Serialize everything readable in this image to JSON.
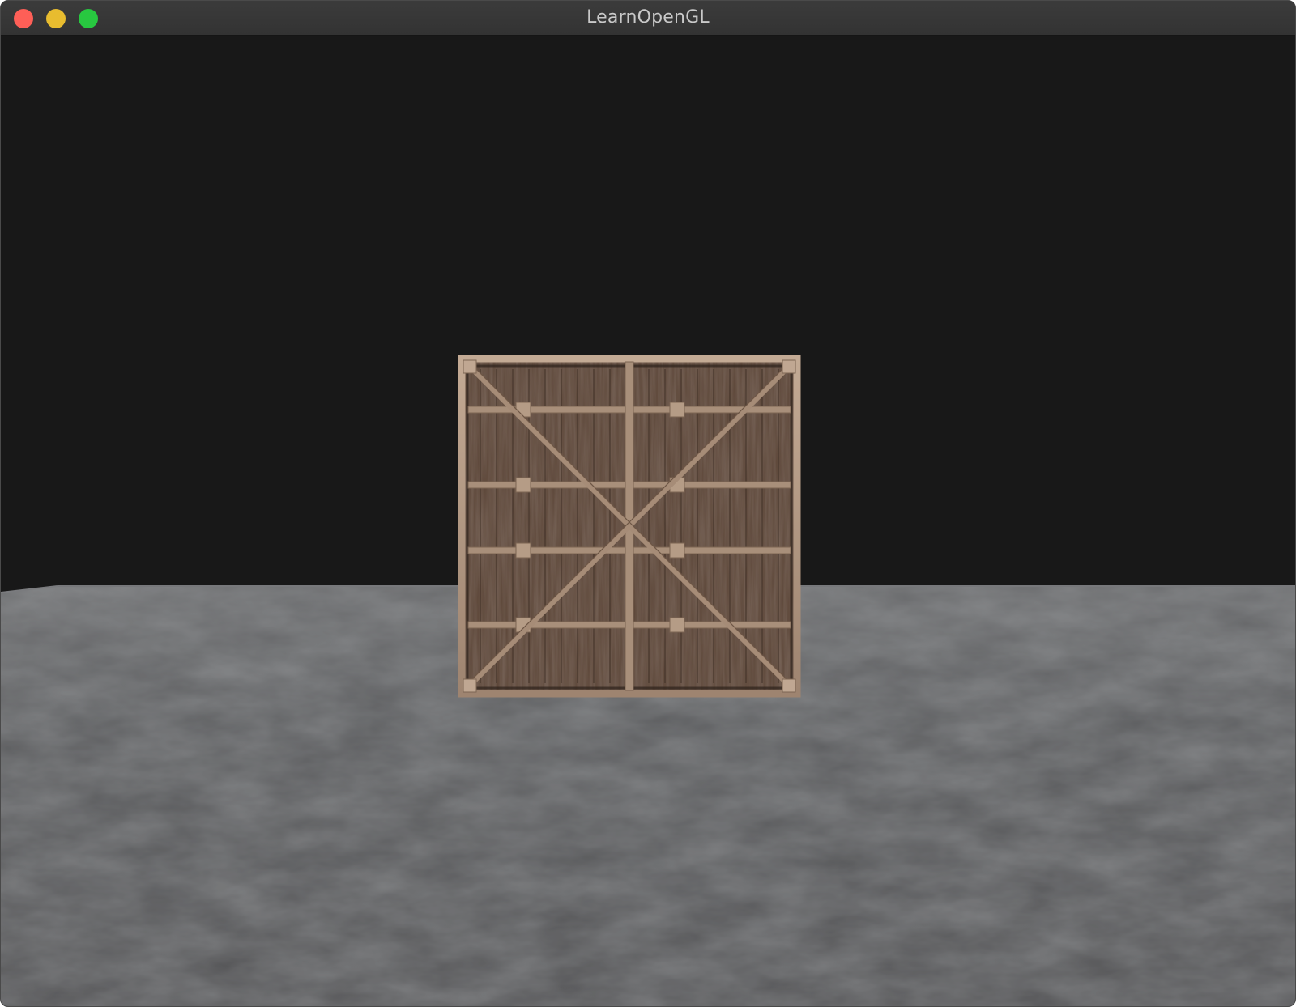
{
  "window": {
    "title": "LearnOpenGL",
    "buttons": [
      {
        "name": "close",
        "color": "#fe5f57"
      },
      {
        "name": "minimize",
        "color": "#e8bc2f"
      },
      {
        "name": "zoom",
        "color": "#28c840"
      }
    ]
  },
  "scene": {
    "clear_color": "#181818",
    "floor_color": "#5a5b5d",
    "crate_color": "#6e5646",
    "crate_frame_color": "#b49a84"
  }
}
